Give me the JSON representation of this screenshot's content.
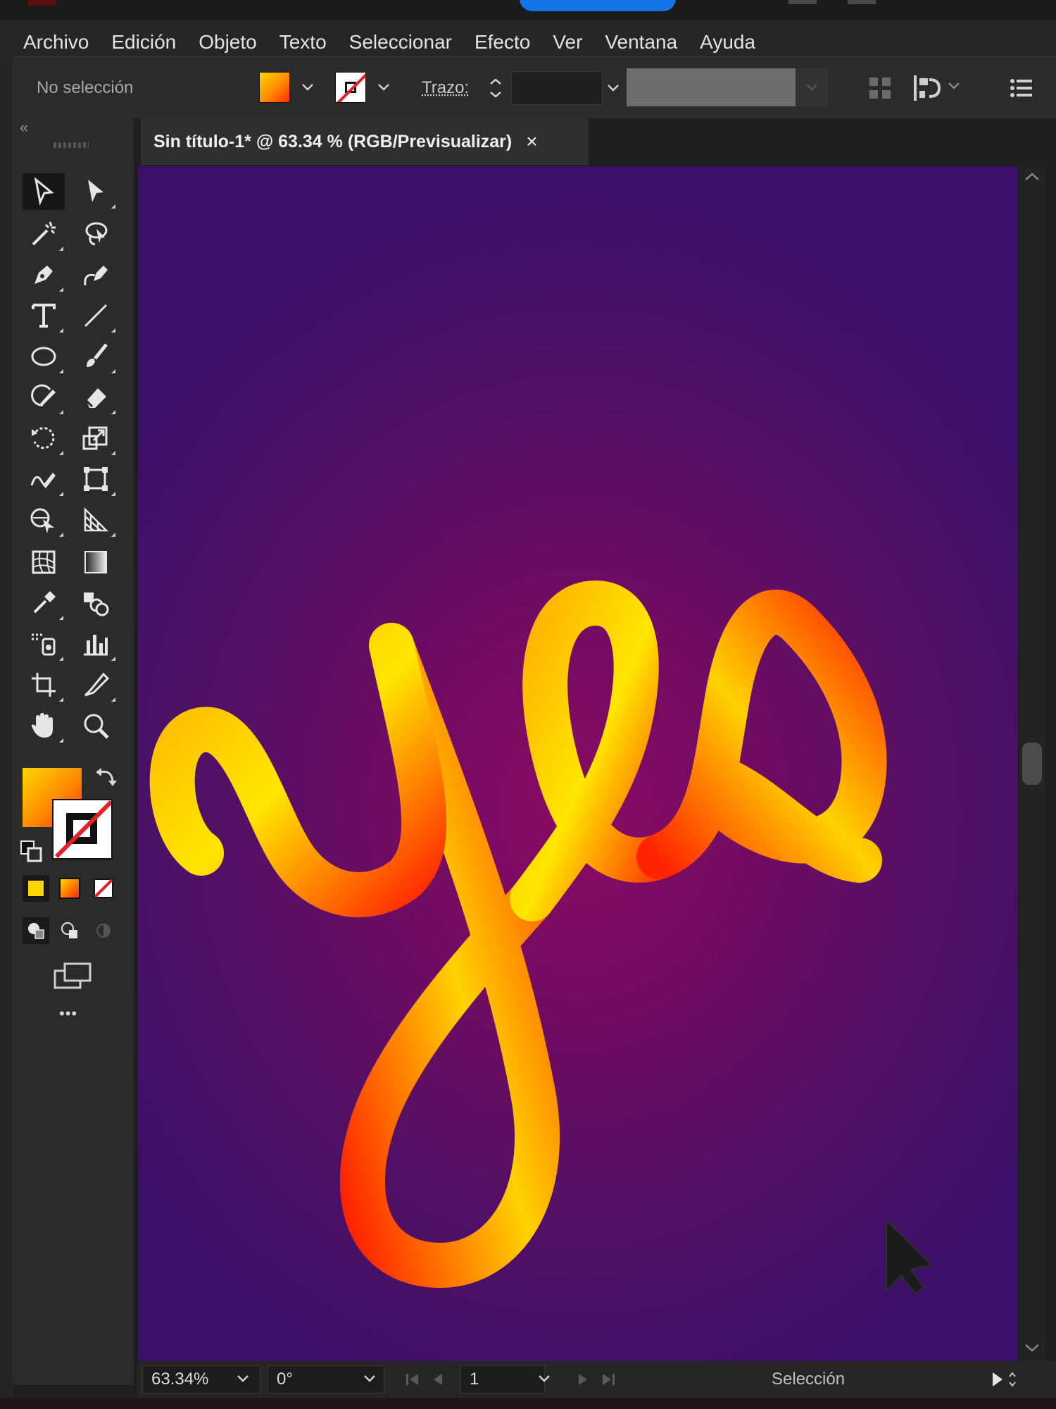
{
  "menu": [
    "Archivo",
    "Edición",
    "Objeto",
    "Texto",
    "Seleccionar",
    "Efecto",
    "Ver",
    "Ventana",
    "Ayuda"
  ],
  "control_bar": {
    "selection_status": "No selección",
    "stroke_label": "Trazo:"
  },
  "document_tab": {
    "title": "Sin título-1* @ 63.34 % (RGB/Previsualizar)",
    "close": "×"
  },
  "toolbar": {
    "collapse": "«",
    "more": "•••"
  },
  "status_bar": {
    "zoom": "63.34%",
    "rotation": "0°",
    "artboard": "1",
    "tool_status": "Selección"
  },
  "colors": {
    "canvas_center": "#8a0a63",
    "canvas_edge": "#3b1069",
    "stroke_warm": "#ff2a00",
    "stroke_hot": "#ffe100"
  }
}
